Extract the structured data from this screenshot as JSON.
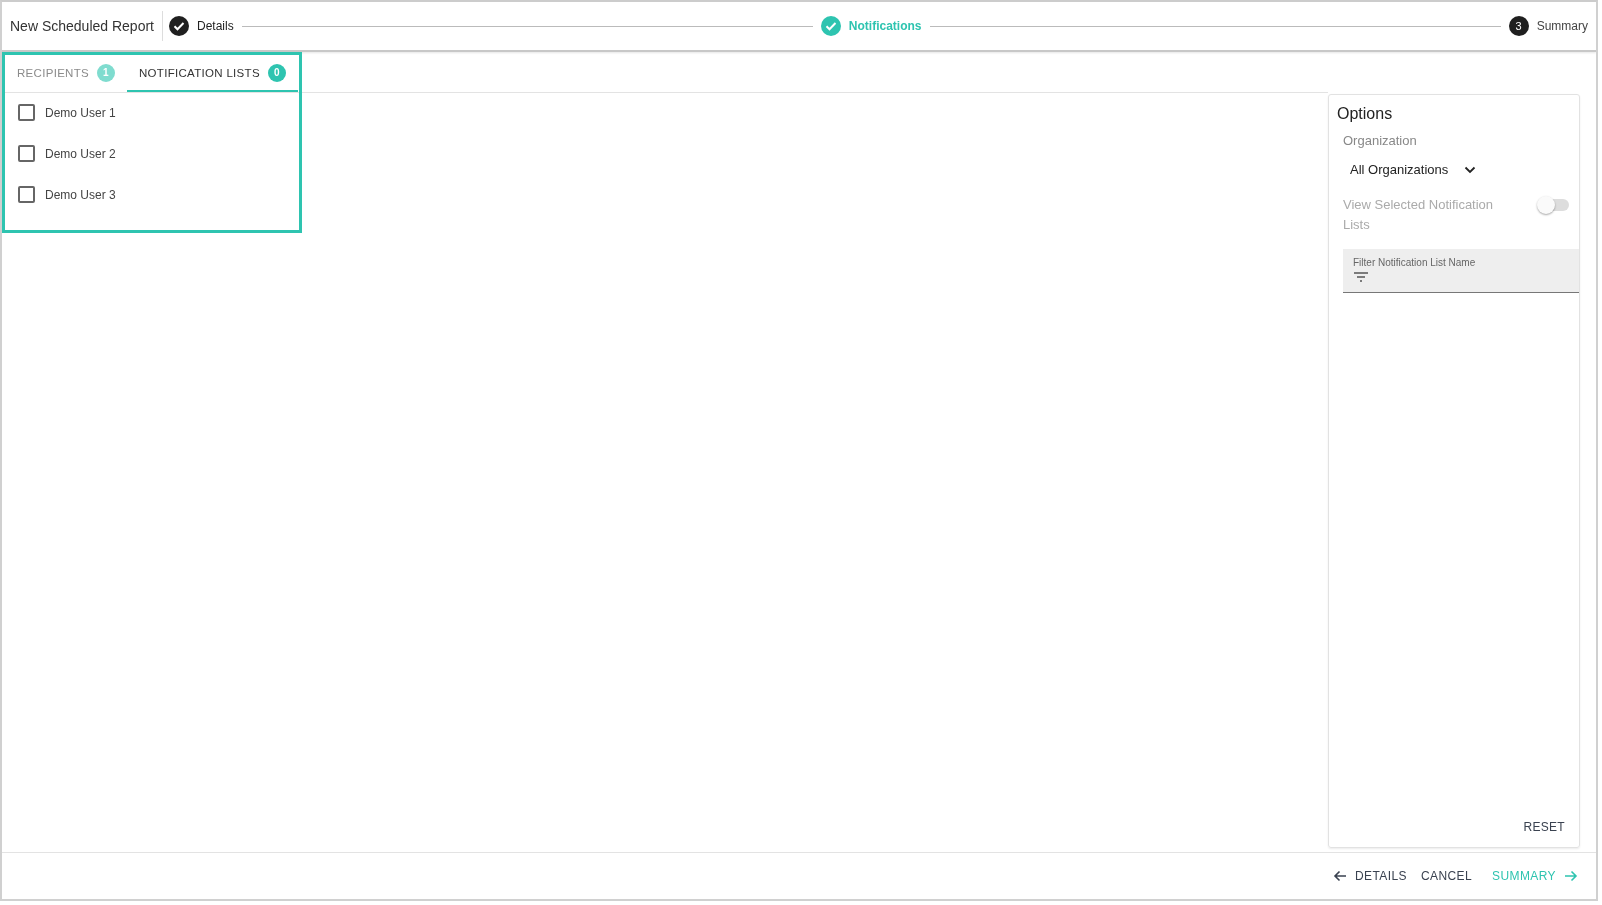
{
  "title": "New Scheduled Report",
  "steps": [
    {
      "label": "Details",
      "kind": "done"
    },
    {
      "label": "Notifications",
      "kind": "current"
    },
    {
      "label": "Summary",
      "kind": "pending",
      "number": "3"
    }
  ],
  "tabs": [
    {
      "label": "RECIPIENTS",
      "count": "1",
      "selected": false
    },
    {
      "label": "NOTIFICATION LISTS",
      "count": "0",
      "selected": true
    }
  ],
  "items": [
    {
      "label": "Demo User 1",
      "checked": false
    },
    {
      "label": "Demo User 2",
      "checked": false
    },
    {
      "label": "Demo User 3",
      "checked": false
    }
  ],
  "options": {
    "title": "Options",
    "organization_label": "Organization",
    "organization_value": "All Organizations",
    "toggle_label": "View Selected Notification Lists",
    "toggle_on": false,
    "filter_placeholder": "Filter Notification List Name",
    "reset": "RESET"
  },
  "footer": {
    "back": "DETAILS",
    "cancel": "CANCEL",
    "next": "SUMMARY"
  }
}
